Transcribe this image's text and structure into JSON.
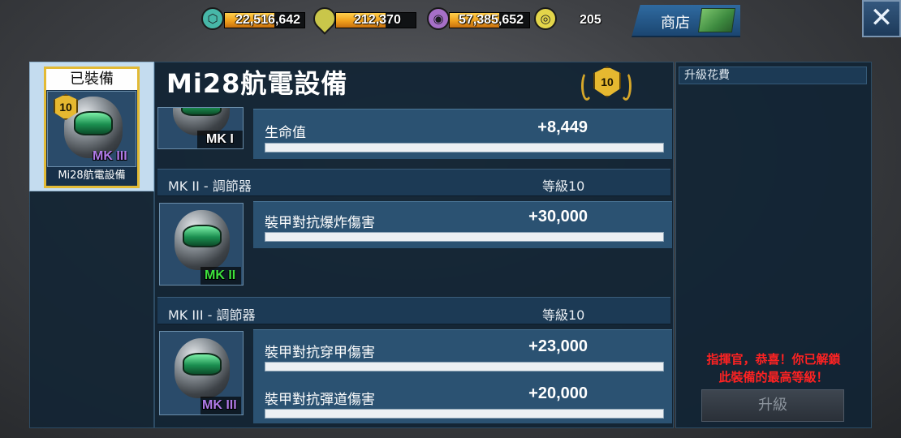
{
  "resources": [
    {
      "icon": "gear-crystal-icon",
      "value": "22,516,642",
      "color": "#47b7a8",
      "bar": true,
      "fill": 0.62
    },
    {
      "icon": "oil-drop-icon",
      "value": "212,370",
      "color": "#c9c64a",
      "bar": true,
      "fill": 0.62
    },
    {
      "icon": "energy-orb-icon",
      "value": "57,385,652",
      "color": "#a66fc7",
      "bar": true,
      "fill": 0.62
    },
    {
      "icon": "gold-coin-icon",
      "value": "205",
      "color": "#e3d54a",
      "bar": false
    }
  ],
  "shop": {
    "label": "商店"
  },
  "close": {
    "label": "✕"
  },
  "equipped": {
    "header": "已裝備",
    "level": "10",
    "mk": "MK III",
    "name": "Mi28航電設備"
  },
  "panel": {
    "title": "Mi28航電設備",
    "level": "10"
  },
  "mk1": {
    "mk": "MK I",
    "stats": [
      {
        "label": "生命值",
        "value": "+8,449"
      }
    ]
  },
  "mk2": {
    "title": "MK II - 調節器",
    "level": "等級10",
    "mk": "MK II",
    "stats": [
      {
        "label": "裝甲對抗爆炸傷害",
        "value": "+30,000"
      }
    ]
  },
  "mk3": {
    "title": "MK III - 調節器",
    "level": "等級10",
    "mk": "MK III",
    "stats": [
      {
        "label": "裝甲對抗穿甲傷害",
        "value": "+23,000"
      },
      {
        "label": "裝甲對抗彈道傷害",
        "value": "+20,000"
      }
    ]
  },
  "upgrade": {
    "cost_label": "升級花費",
    "max_message_line1": "指揮官，恭喜！你已解鎖",
    "max_message_line2": "此裝備的最高等級！",
    "button": "升級"
  },
  "colors": {
    "mk1": "#ffffff",
    "mk2": "#3ee23e",
    "mk3": "#b07be8",
    "warning": "#ff2222"
  }
}
